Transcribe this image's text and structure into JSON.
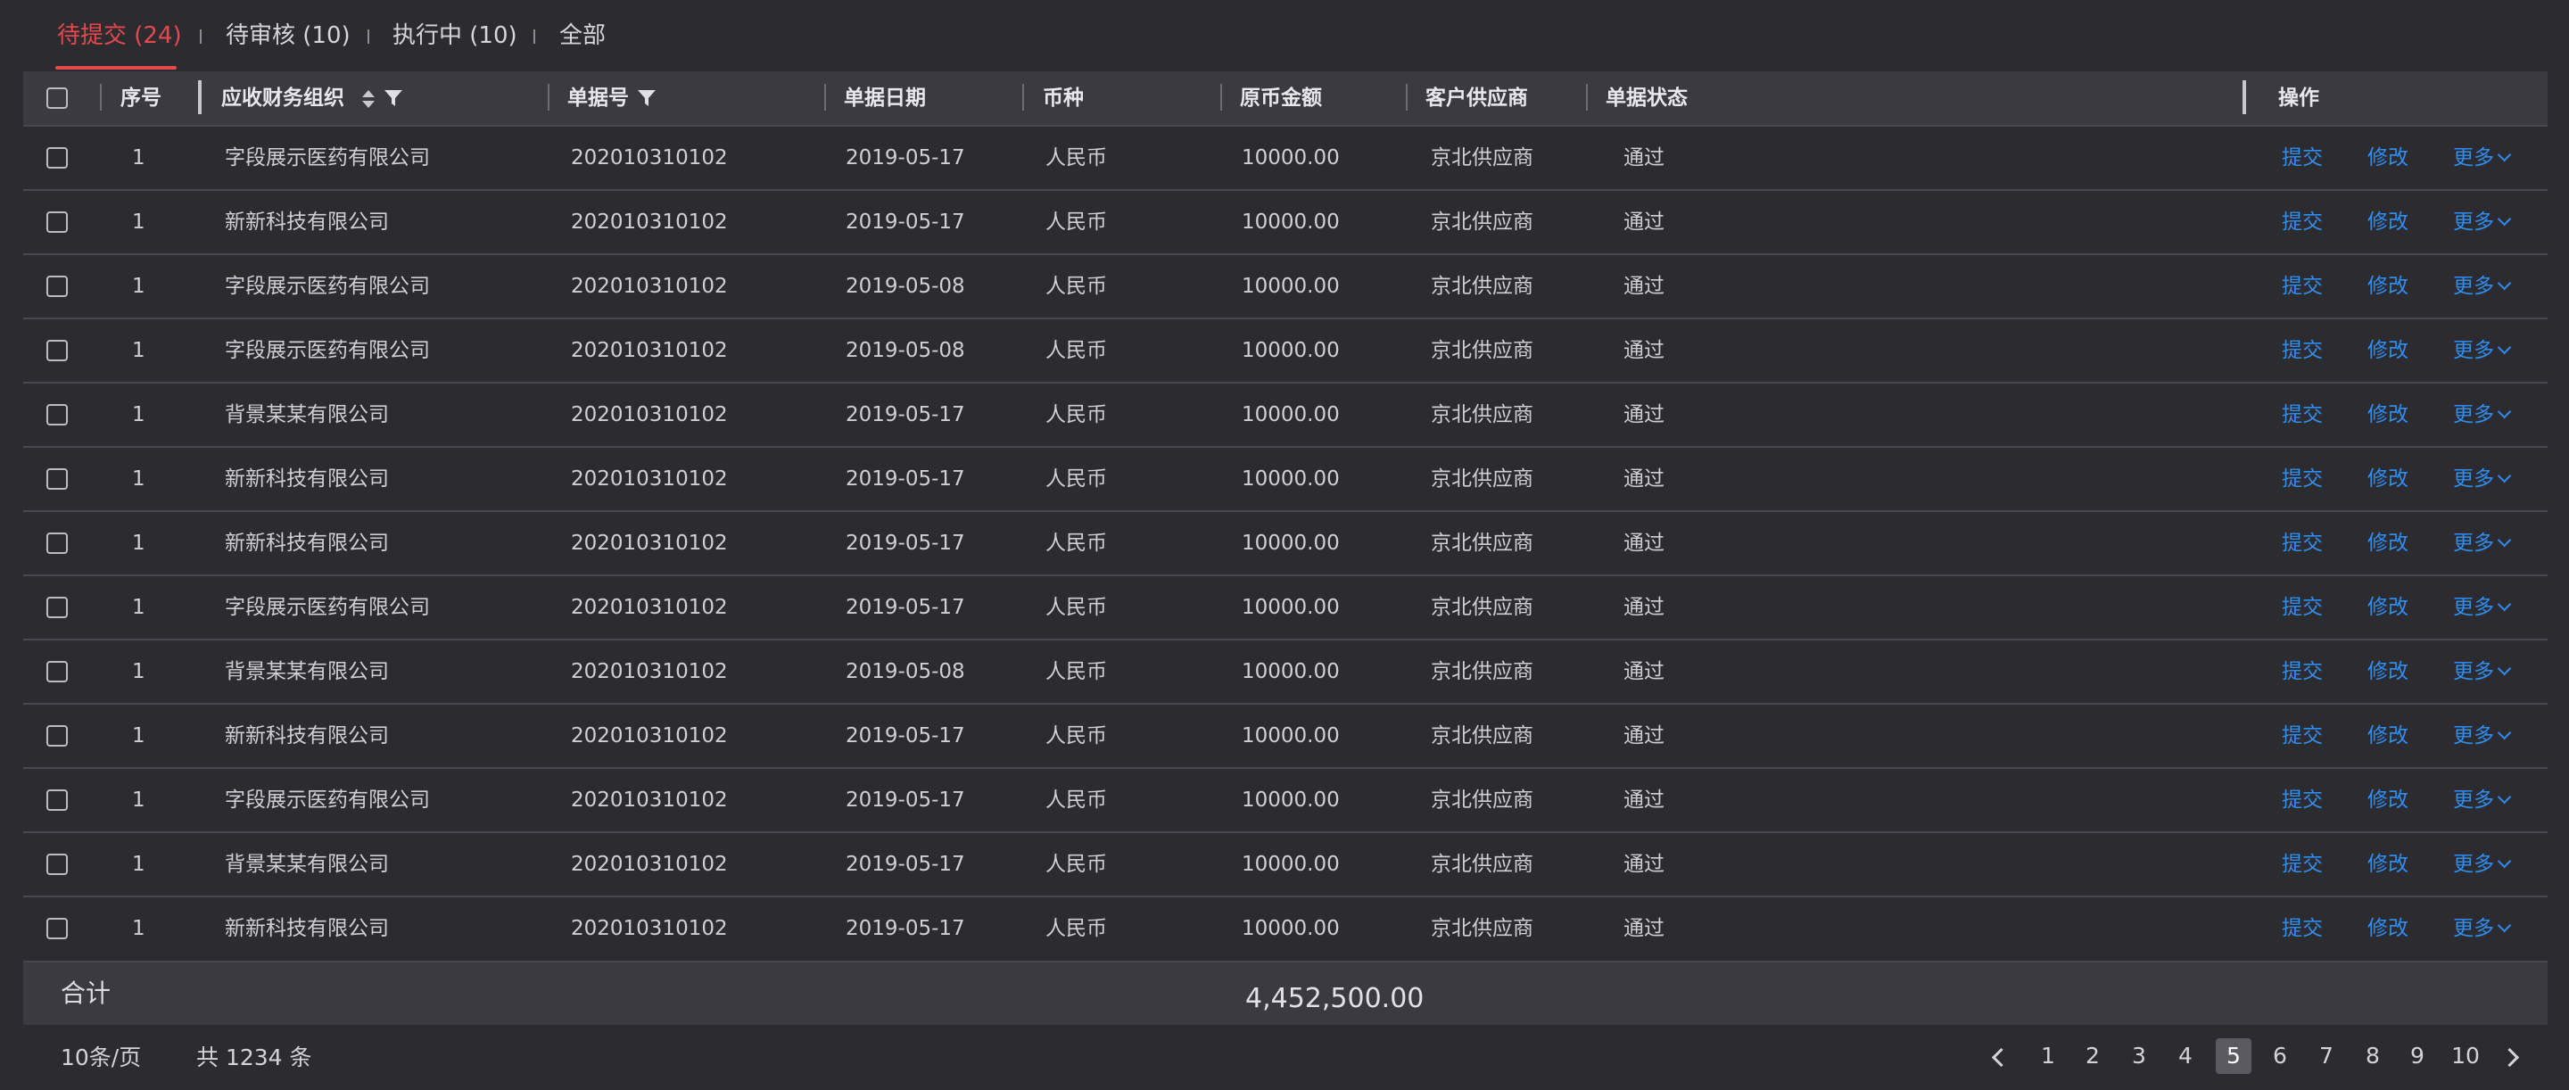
{
  "tabs": [
    {
      "label": "待提交 (24)",
      "active": true
    },
    {
      "label": "待审核 (10)",
      "active": false
    },
    {
      "label": "执行中 (10)",
      "active": false
    },
    {
      "label": "全部",
      "active": false
    }
  ],
  "table": {
    "headers": {
      "index": "序号",
      "org": "应收财务组织",
      "bill_no": "单据号",
      "bill_date": "单据日期",
      "currency": "币种",
      "amount": "原币金额",
      "supplier": "客户供应商",
      "status": "单据状态",
      "actions": "操作"
    },
    "rows": [
      {
        "index": "1",
        "org": "字段展示医药有限公司",
        "bill_no": "202010310102",
        "bill_date": "2019-05-17",
        "currency": "人民币",
        "amount": "10000.00",
        "supplier": "京北供应商",
        "status": "通过"
      },
      {
        "index": "1",
        "org": "新新科技有限公司",
        "bill_no": "202010310102",
        "bill_date": "2019-05-17",
        "currency": "人民币",
        "amount": "10000.00",
        "supplier": "京北供应商",
        "status": "通过"
      },
      {
        "index": "1",
        "org": "字段展示医药有限公司",
        "bill_no": "202010310102",
        "bill_date": "2019-05-08",
        "currency": "人民币",
        "amount": "10000.00",
        "supplier": "京北供应商",
        "status": "通过"
      },
      {
        "index": "1",
        "org": "字段展示医药有限公司",
        "bill_no": "202010310102",
        "bill_date": "2019-05-08",
        "currency": "人民币",
        "amount": "10000.00",
        "supplier": "京北供应商",
        "status": "通过"
      },
      {
        "index": "1",
        "org": "背景某某有限公司",
        "bill_no": "202010310102",
        "bill_date": "2019-05-17",
        "currency": "人民币",
        "amount": "10000.00",
        "supplier": "京北供应商",
        "status": "通过"
      },
      {
        "index": "1",
        "org": "新新科技有限公司",
        "bill_no": "202010310102",
        "bill_date": "2019-05-17",
        "currency": "人民币",
        "amount": "10000.00",
        "supplier": "京北供应商",
        "status": "通过"
      },
      {
        "index": "1",
        "org": "新新科技有限公司",
        "bill_no": "202010310102",
        "bill_date": "2019-05-17",
        "currency": "人民币",
        "amount": "10000.00",
        "supplier": "京北供应商",
        "status": "通过"
      },
      {
        "index": "1",
        "org": "字段展示医药有限公司",
        "bill_no": "202010310102",
        "bill_date": "2019-05-17",
        "currency": "人民币",
        "amount": "10000.00",
        "supplier": "京北供应商",
        "status": "通过"
      },
      {
        "index": "1",
        "org": "背景某某有限公司",
        "bill_no": "202010310102",
        "bill_date": "2019-05-08",
        "currency": "人民币",
        "amount": "10000.00",
        "supplier": "京北供应商",
        "status": "通过"
      },
      {
        "index": "1",
        "org": "新新科技有限公司",
        "bill_no": "202010310102",
        "bill_date": "2019-05-17",
        "currency": "人民币",
        "amount": "10000.00",
        "supplier": "京北供应商",
        "status": "通过"
      },
      {
        "index": "1",
        "org": "字段展示医药有限公司",
        "bill_no": "202010310102",
        "bill_date": "2019-05-17",
        "currency": "人民币",
        "amount": "10000.00",
        "supplier": "京北供应商",
        "status": "通过"
      },
      {
        "index": "1",
        "org": "背景某某有限公司",
        "bill_no": "202010310102",
        "bill_date": "2019-05-17",
        "currency": "人民币",
        "amount": "10000.00",
        "supplier": "京北供应商",
        "status": "通过"
      },
      {
        "index": "1",
        "org": "新新科技有限公司",
        "bill_no": "202010310102",
        "bill_date": "2019-05-17",
        "currency": "人民币",
        "amount": "10000.00",
        "supplier": "京北供应商",
        "status": "通过"
      }
    ],
    "row_actions": {
      "submit": "提交",
      "edit": "修改",
      "more": "更多"
    }
  },
  "summary": {
    "label": "合计",
    "total": "4,452,500.00"
  },
  "pagination": {
    "page_size": "10条/页",
    "total_prefix": "共",
    "total_count": "1234",
    "total_suffix": "条",
    "pages": [
      "1",
      "2",
      "3",
      "4",
      "5",
      "6",
      "7",
      "8",
      "9",
      "10"
    ],
    "current": "5"
  },
  "colors": {
    "accent": "#e5484d",
    "link": "#2f8ef0",
    "background": "#2b2b30",
    "header_bg": "#3a3a40"
  }
}
